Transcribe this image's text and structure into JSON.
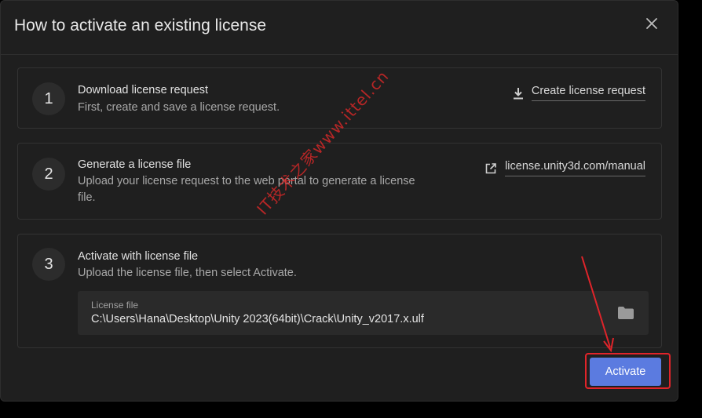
{
  "dialog": {
    "title": "How to activate an existing license"
  },
  "steps": [
    {
      "number": "1",
      "title": "Download license request",
      "description": "First, create and save a license request.",
      "action": {
        "label": "Create license request",
        "icon": "download-icon"
      }
    },
    {
      "number": "2",
      "title": "Generate a license file",
      "description": "Upload your license request to the web portal to generate a license file.",
      "action": {
        "label": "license.unity3d.com/manual",
        "icon": "external-link-icon"
      }
    },
    {
      "number": "3",
      "title": "Activate with license file",
      "description": "Upload the license file, then select Activate.",
      "file_field": {
        "label": "License file",
        "value": "C:\\Users\\Hana\\Desktop\\Unity 2023(64bit)\\Crack\\Unity_v2017.x.ulf",
        "icon": "folder-icon"
      }
    }
  ],
  "footer": {
    "activate_label": "Activate"
  },
  "watermark": "IT技术之家www.ittel.cn",
  "colors": {
    "background": "#1f1f1f",
    "accent": "#5b7be0",
    "annotation": "#e0242a"
  }
}
